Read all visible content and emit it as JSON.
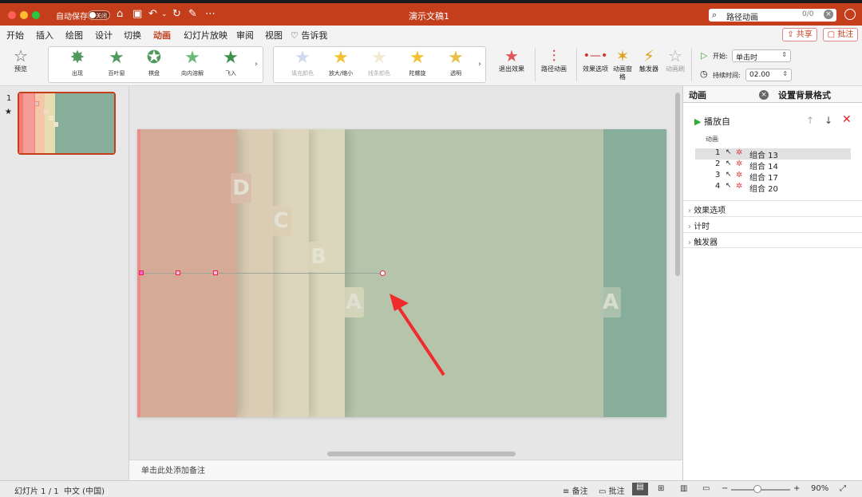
{
  "window": {
    "title": "演示文稿1",
    "autosave_label": "自动保存",
    "autosave_state": "关闭"
  },
  "search": {
    "value": "路径动画",
    "count": "0/0"
  },
  "tabs": [
    "开始",
    "插入",
    "绘图",
    "设计",
    "切换",
    "动画",
    "幻灯片放映",
    "审阅",
    "视图",
    "告诉我"
  ],
  "active_tab": "动画",
  "share_label": "共享",
  "comment_label": "批注",
  "ribbon": {
    "preview": "预览",
    "entrance": [
      {
        "label": "出现",
        "icon": "star-appear-icon"
      },
      {
        "label": "百叶窗",
        "icon": "star-blinds-icon"
      },
      {
        "label": "棋盘",
        "icon": "star-checkerboard-icon"
      },
      {
        "label": "向内溶解",
        "icon": "star-dissolve-icon"
      },
      {
        "label": "飞入",
        "icon": "star-flyin-icon"
      }
    ],
    "emphasis": [
      {
        "label": "填充颜色",
        "icon": "star-fill-icon",
        "dim": true
      },
      {
        "label": "放大/缩小",
        "icon": "star-grow-icon",
        "dim": false
      },
      {
        "label": "线条颜色",
        "icon": "star-line-icon",
        "dim": true
      },
      {
        "label": "陀螺旋",
        "icon": "star-spin-icon",
        "dim": false
      },
      {
        "label": "透明",
        "icon": "star-transparent-icon",
        "dim": false
      }
    ],
    "exit": "退出效果",
    "path": "路径动画",
    "effect_options": "效果选项",
    "pane": "动画窗格",
    "trigger": "触发器",
    "anim_brush": "动画刷",
    "start_label": "开始:",
    "start_value": "单击时",
    "duration_label": "持续时间:",
    "duration_value": "02.00"
  },
  "thumbnail": {
    "index": "1",
    "star": "★"
  },
  "slide": {
    "labels": [
      "D",
      "C",
      "B",
      "A",
      "A"
    ]
  },
  "notes_placeholder": "单击此处添加备注",
  "pane": {
    "tab_animation": "动画",
    "tab_background": "设置背景格式",
    "play_from": "播放自",
    "list_header": "动画",
    "items": [
      {
        "num": "1",
        "name": "组合 13"
      },
      {
        "num": "2",
        "name": "组合 14"
      },
      {
        "num": "3",
        "name": "组合 17"
      },
      {
        "num": "4",
        "name": "组合 20"
      }
    ],
    "sections": [
      "效果选项",
      "计时",
      "触发器"
    ]
  },
  "status": {
    "slide": "幻灯片 1 / 1",
    "lang": "中文 (中国)",
    "notes": "备注",
    "comments": "批注",
    "zoom": "90%"
  },
  "colors": {
    "accent": "#c43e1c",
    "slide_bg": "#b6c4ab",
    "teal": "#87ad9b",
    "pink": "#d5ab97"
  }
}
